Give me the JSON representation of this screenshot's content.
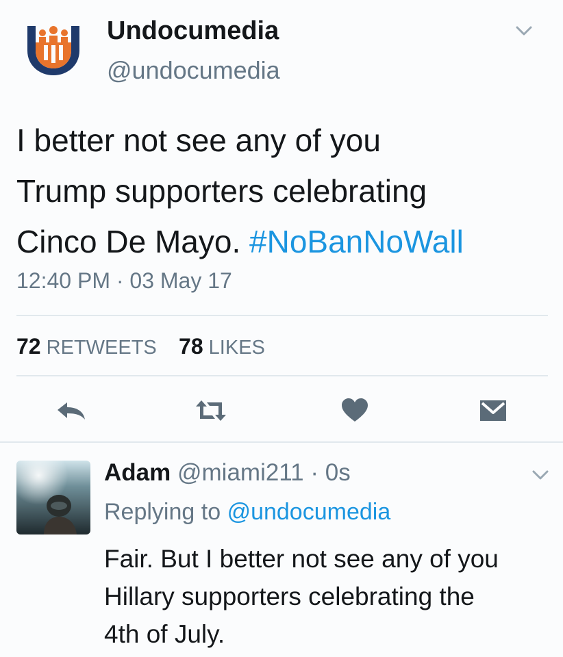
{
  "tweet": {
    "display_name": "Undocumedia",
    "handle": "@undocumedia",
    "text": "I better not see any of you Trump supporters celebrating Cinco De Mayo. ",
    "text_line1": "I better not see any of you",
    "text_line2": "Trump supporters celebrating",
    "text_line3": "Cinco De Mayo. ",
    "hashtag": "#NoBanNoWall",
    "timestamp": "12:40 PM · 03 May 17",
    "retweets_count": "72",
    "retweets_label": "RETWEETS",
    "likes_count": "78",
    "likes_label": "LIKES"
  },
  "reply": {
    "display_name": "Adam",
    "handle": "@miami211",
    "time": "· 0s",
    "replying_prefix": "Replying to",
    "replying_to": "@undocumedia",
    "text_line1": "Fair. But I better not see any of you",
    "text_line2": "Hillary supporters celebrating the",
    "text_line3": "4th of July."
  },
  "colors": {
    "background": "#fbfcfd",
    "text": "#14171a",
    "secondary": "#657786",
    "link": "#1b95e0",
    "icon": "#5b6b78",
    "logo_navy": "#1f3a6b",
    "logo_orange": "#e8742c"
  },
  "icons": {
    "header_menu": "chevron-down-icon",
    "reply": "reply-icon",
    "retweet": "retweet-icon",
    "like": "heart-icon",
    "dm": "envelope-icon"
  }
}
